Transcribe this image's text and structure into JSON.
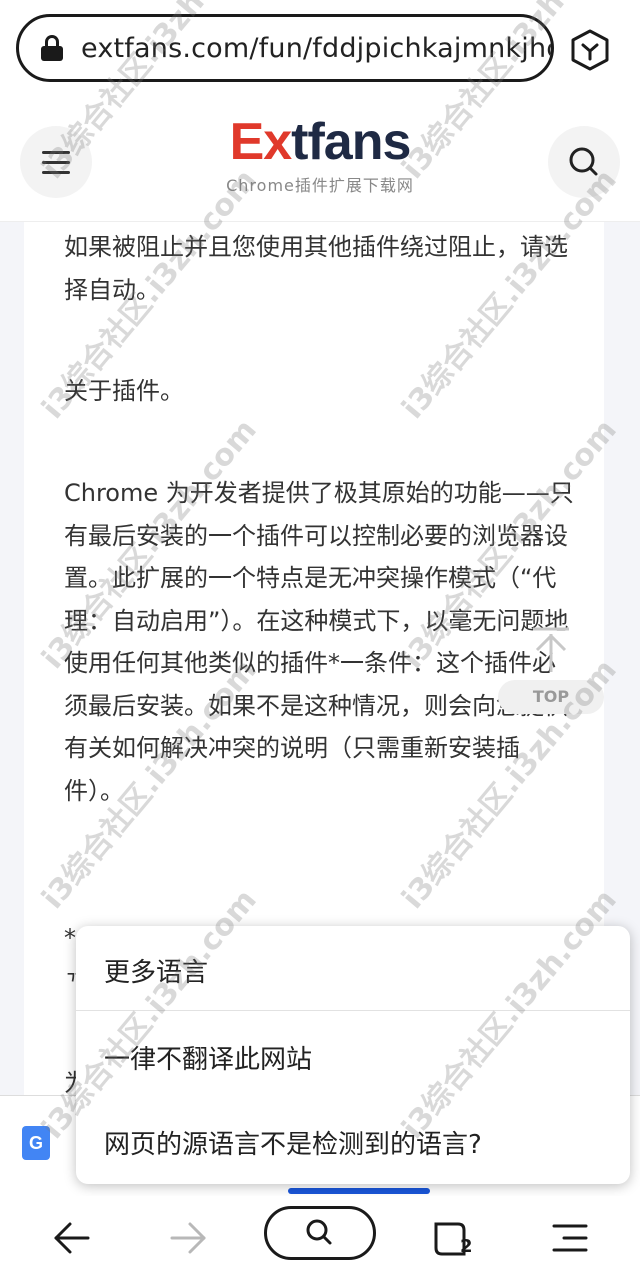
{
  "browser": {
    "url": "extfans.com/fun/fddjpichkajmnkjhci",
    "tab_count": "2"
  },
  "site": {
    "logo_ex": "Ex",
    "logo_rest": "tfans",
    "logo_sub": "Chrome插件扩展下载网"
  },
  "article": {
    "p1": "如果被阻止并且您使用其他插件绕过阻止，请选择自动。",
    "p2": "关于插件。",
    "p3": "Chrome 为开发者提供了极其原始的功能——只有最后安装的一个插件可以控制必要的浏览器设置。此扩展的一个特点是无冲突操作模式（“代理：自动启用”）。在这种模式下，以毫无问题地使用任何其他类似的插件*一条件：这个插件必须最后安装。如果不是这种情况，则会向您提供有关如何解决冲突的说明（只需重新安装插件）。",
    "p4a": "*",
    "p4b": "ᄁ",
    "p4c": "为"
  },
  "back_to_top": {
    "label": "TOP"
  },
  "translate": {
    "google_icon_letter": "G",
    "menu": {
      "more_languages": "更多语言",
      "never_translate_site": "一律不翻译此网站",
      "wrong_source_language": "网页的源语言不是检测到的语言?"
    }
  },
  "watermark": {
    "text": "i3综合社区.i3zh.com"
  }
}
